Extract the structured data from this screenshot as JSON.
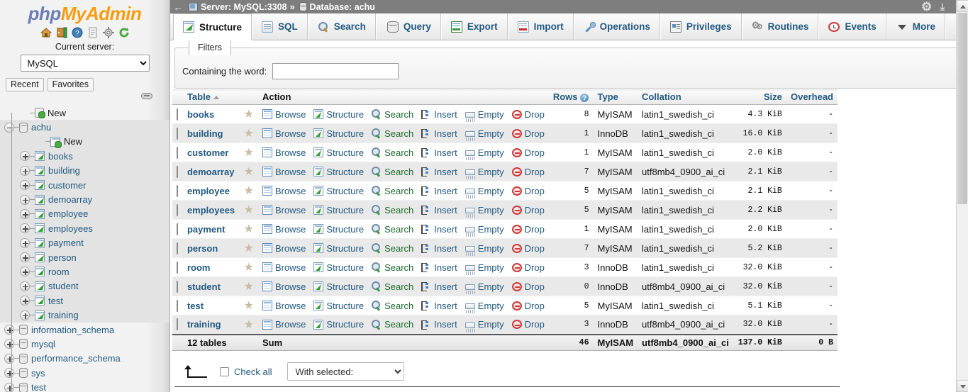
{
  "sidebar": {
    "logo": {
      "php": "php",
      "myadmin": "MyAdmin"
    },
    "quick_icons": [
      {
        "name": "home-icon"
      },
      {
        "name": "logout-icon"
      },
      {
        "name": "documentation-icon"
      },
      {
        "name": "sql-help-icon"
      },
      {
        "name": "settings-icon"
      },
      {
        "name": "reload-icon"
      }
    ],
    "current_server_label": "Current server:",
    "server_value": "MySQL",
    "recent_label": "Recent",
    "favorites_label": "Favorites",
    "tree": [
      {
        "label": "New",
        "type": "new-db",
        "depth": 1,
        "expander": "none",
        "highlight": false
      },
      {
        "label": "achu",
        "type": "database",
        "depth": 0,
        "expander": "minus",
        "highlight": true
      },
      {
        "label": "New",
        "type": "new-table",
        "depth": 2,
        "expander": "none",
        "highlight": true
      },
      {
        "label": "books",
        "type": "table",
        "depth": 1,
        "expander": "plus",
        "highlight": true
      },
      {
        "label": "building",
        "type": "table",
        "depth": 1,
        "expander": "plus",
        "highlight": true
      },
      {
        "label": "customer",
        "type": "table",
        "depth": 1,
        "expander": "plus",
        "highlight": true
      },
      {
        "label": "demoarray",
        "type": "table",
        "depth": 1,
        "expander": "plus",
        "highlight": true
      },
      {
        "label": "employee",
        "type": "table",
        "depth": 1,
        "expander": "plus",
        "highlight": true
      },
      {
        "label": "employees",
        "type": "table",
        "depth": 1,
        "expander": "plus",
        "highlight": true
      },
      {
        "label": "payment",
        "type": "table",
        "depth": 1,
        "expander": "plus",
        "highlight": true
      },
      {
        "label": "person",
        "type": "table",
        "depth": 1,
        "expander": "plus",
        "highlight": true
      },
      {
        "label": "room",
        "type": "table",
        "depth": 1,
        "expander": "plus",
        "highlight": true
      },
      {
        "label": "student",
        "type": "table",
        "depth": 1,
        "expander": "plus",
        "highlight": true
      },
      {
        "label": "test",
        "type": "table",
        "depth": 1,
        "expander": "plus",
        "highlight": true
      },
      {
        "label": "training",
        "type": "table",
        "depth": 1,
        "expander": "plus",
        "highlight": true
      },
      {
        "label": "information_schema",
        "type": "database",
        "depth": 0,
        "expander": "plus",
        "highlight": false
      },
      {
        "label": "mysql",
        "type": "database",
        "depth": 0,
        "expander": "plus",
        "highlight": false
      },
      {
        "label": "performance_schema",
        "type": "database",
        "depth": 0,
        "expander": "plus",
        "highlight": false
      },
      {
        "label": "sys",
        "type": "database",
        "depth": 0,
        "expander": "plus",
        "highlight": false
      },
      {
        "label": "test",
        "type": "database",
        "depth": 0,
        "expander": "plus",
        "highlight": false
      }
    ]
  },
  "breadcrumb": {
    "back": "←",
    "server": "Server: MySQL:3308",
    "separator": "»",
    "database": "Database: achu"
  },
  "tabs": [
    {
      "label": "Structure",
      "icon": "structure-icon",
      "active": true
    },
    {
      "label": "SQL",
      "icon": "sql-icon",
      "active": false
    },
    {
      "label": "Search",
      "icon": "search-icon",
      "active": false
    },
    {
      "label": "Query",
      "icon": "query-icon",
      "active": false
    },
    {
      "label": "Export",
      "icon": "export-icon",
      "active": false
    },
    {
      "label": "Import",
      "icon": "import-icon",
      "active": false
    },
    {
      "label": "Operations",
      "icon": "operations-icon",
      "active": false
    },
    {
      "label": "Privileges",
      "icon": "privileges-icon",
      "active": false
    },
    {
      "label": "Routines",
      "icon": "routines-icon",
      "active": false
    },
    {
      "label": "Events",
      "icon": "events-icon",
      "active": false
    },
    {
      "label": "More",
      "icon": "chevron-down-icon",
      "active": false
    }
  ],
  "filters": {
    "legend": "Filters",
    "containing_label": "Containing the word:",
    "containing_value": "",
    "containing_placeholder": ""
  },
  "table": {
    "headers": {
      "table": "Table",
      "action": "Action",
      "rows": "Rows",
      "type": "Type",
      "collation": "Collation",
      "size": "Size",
      "overhead": "Overhead"
    },
    "action_labels": {
      "browse": "Browse",
      "structure": "Structure",
      "search": "Search",
      "insert": "Insert",
      "empty": "Empty",
      "drop": "Drop"
    },
    "rows": [
      {
        "name": "books",
        "rows": "8",
        "type": "MyISAM",
        "collation": "latin1_swedish_ci",
        "size": "4.3 KiB",
        "overhead": "-"
      },
      {
        "name": "building",
        "rows": "1",
        "type": "InnoDB",
        "collation": "latin1_swedish_ci",
        "size": "16.0 KiB",
        "overhead": "-"
      },
      {
        "name": "customer",
        "rows": "1",
        "type": "MyISAM",
        "collation": "latin1_swedish_ci",
        "size": "2.0 KiB",
        "overhead": "-"
      },
      {
        "name": "demoarray",
        "rows": "7",
        "type": "MyISAM",
        "collation": "utf8mb4_0900_ai_ci",
        "size": "2.1 KiB",
        "overhead": "-"
      },
      {
        "name": "employee",
        "rows": "5",
        "type": "MyISAM",
        "collation": "latin1_swedish_ci",
        "size": "2.1 KiB",
        "overhead": "-"
      },
      {
        "name": "employees",
        "rows": "5",
        "type": "MyISAM",
        "collation": "latin1_swedish_ci",
        "size": "2.2 KiB",
        "overhead": "-"
      },
      {
        "name": "payment",
        "rows": "1",
        "type": "MyISAM",
        "collation": "latin1_swedish_ci",
        "size": "2.0 KiB",
        "overhead": "-"
      },
      {
        "name": "person",
        "rows": "7",
        "type": "MyISAM",
        "collation": "latin1_swedish_ci",
        "size": "5.2 KiB",
        "overhead": "-"
      },
      {
        "name": "room",
        "rows": "3",
        "type": "InnoDB",
        "collation": "latin1_swedish_ci",
        "size": "32.0 KiB",
        "overhead": "-"
      },
      {
        "name": "student",
        "rows": "0",
        "type": "InnoDB",
        "collation": "utf8mb4_0900_ai_ci",
        "size": "32.0 KiB",
        "overhead": "-"
      },
      {
        "name": "test",
        "rows": "5",
        "type": "MyISAM",
        "collation": "latin1_swedish_ci",
        "size": "5.1 KiB",
        "overhead": "-"
      },
      {
        "name": "training",
        "rows": "3",
        "type": "InnoDB",
        "collation": "utf8mb4_0900_ai_ci",
        "size": "32.0 KiB",
        "overhead": "-"
      }
    ],
    "summary": {
      "count": "12 tables",
      "sum_label": "Sum",
      "rows": "46",
      "type": "MyISAM",
      "collation": "utf8mb4_0900_ai_ci",
      "size": "137.0 KiB",
      "overhead": "0 B"
    }
  },
  "footer": {
    "check_all": "Check all",
    "with_selected": "With selected:"
  }
}
